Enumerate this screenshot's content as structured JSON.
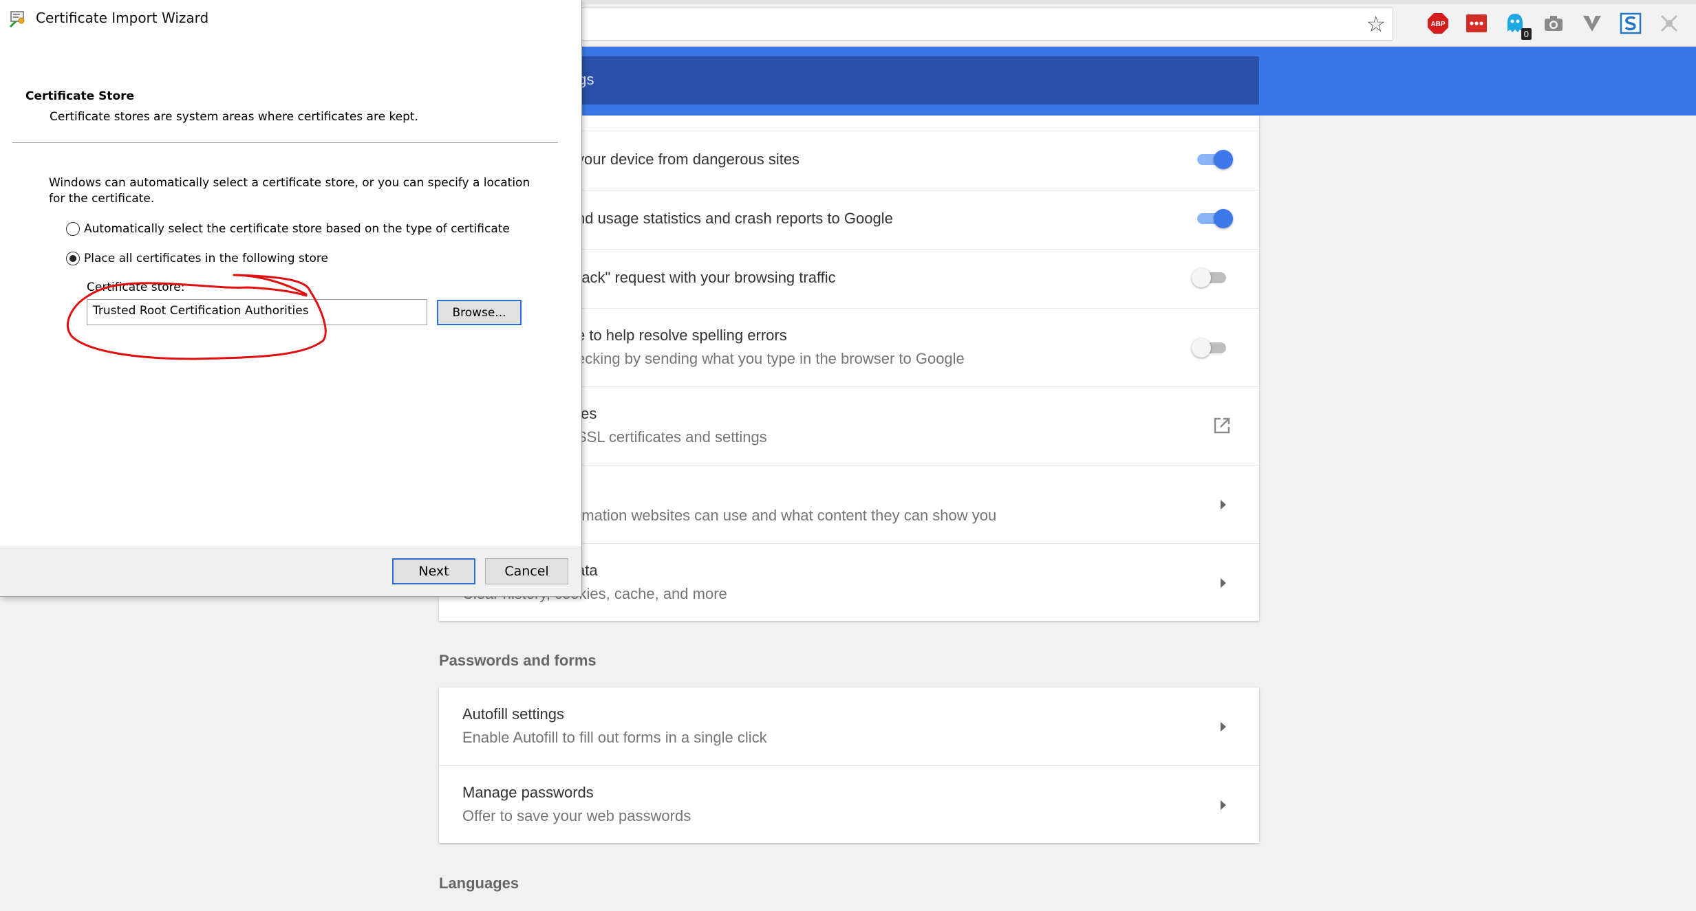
{
  "browser": {
    "extensions": [
      {
        "name": "adblock-plus-icon",
        "label": "ABP"
      },
      {
        "name": "lastpass-icon"
      },
      {
        "name": "ghostery-icon",
        "badge": "0"
      },
      {
        "name": "camera-icon"
      },
      {
        "name": "vivaldi-icon"
      },
      {
        "name": "s-extension-icon"
      },
      {
        "name": "puzzle-icon"
      }
    ],
    "colors": {
      "accent": "#3b78e7",
      "header_dark": "#2a50a9",
      "toggle_on": "#3c78e8"
    }
  },
  "settings": {
    "header_fragment": "ngs",
    "privacy_rows": [
      {
        "title": "your device from dangerous sites",
        "subtitle": "",
        "control": "toggle-on"
      },
      {
        "title": "nd usage statistics and crash reports to Google",
        "subtitle": "",
        "control": "toggle-on"
      },
      {
        "title": "rack\" request with your browsing traffic",
        "subtitle": "",
        "control": "toggle-off"
      },
      {
        "title": "e to help resolve spelling errors",
        "subtitle": "ecking by sending what you type in the browser to Google",
        "control": "toggle-off"
      },
      {
        "title": "tes",
        "subtitle": "SSL certificates and settings",
        "control": "external-link"
      },
      {
        "title": "",
        "subtitle": "rmation websites can use and what content they can show you",
        "control": "arrow"
      },
      {
        "title": "ata",
        "subtitle": "Clear history, cookies, cache, and more",
        "control": "arrow"
      }
    ],
    "passwords_section": "Passwords and forms",
    "password_rows": [
      {
        "title": "Autofill settings",
        "subtitle": "Enable Autofill to fill out forms in a single click"
      },
      {
        "title": "Manage passwords",
        "subtitle": "Offer to save your web passwords"
      }
    ],
    "languages_section": "Languages"
  },
  "wizard": {
    "title": "Certificate Import Wizard",
    "heading": "Certificate Store",
    "subheading": "Certificate stores are system areas where certificates are kept.",
    "description": "Windows can automatically select a certificate store, or you can specify a location for the certificate.",
    "option_auto": "Automatically select the certificate store based on the type of certificate",
    "option_manual": "Place all certificates in the following store",
    "selected_option": "manual",
    "store_label": "Certificate store:",
    "store_value": "Trusted Root Certification Authorities",
    "browse_label": "Browse...",
    "next_label": "Next",
    "cancel_label": "Cancel",
    "annotation_color": "#e01010"
  }
}
